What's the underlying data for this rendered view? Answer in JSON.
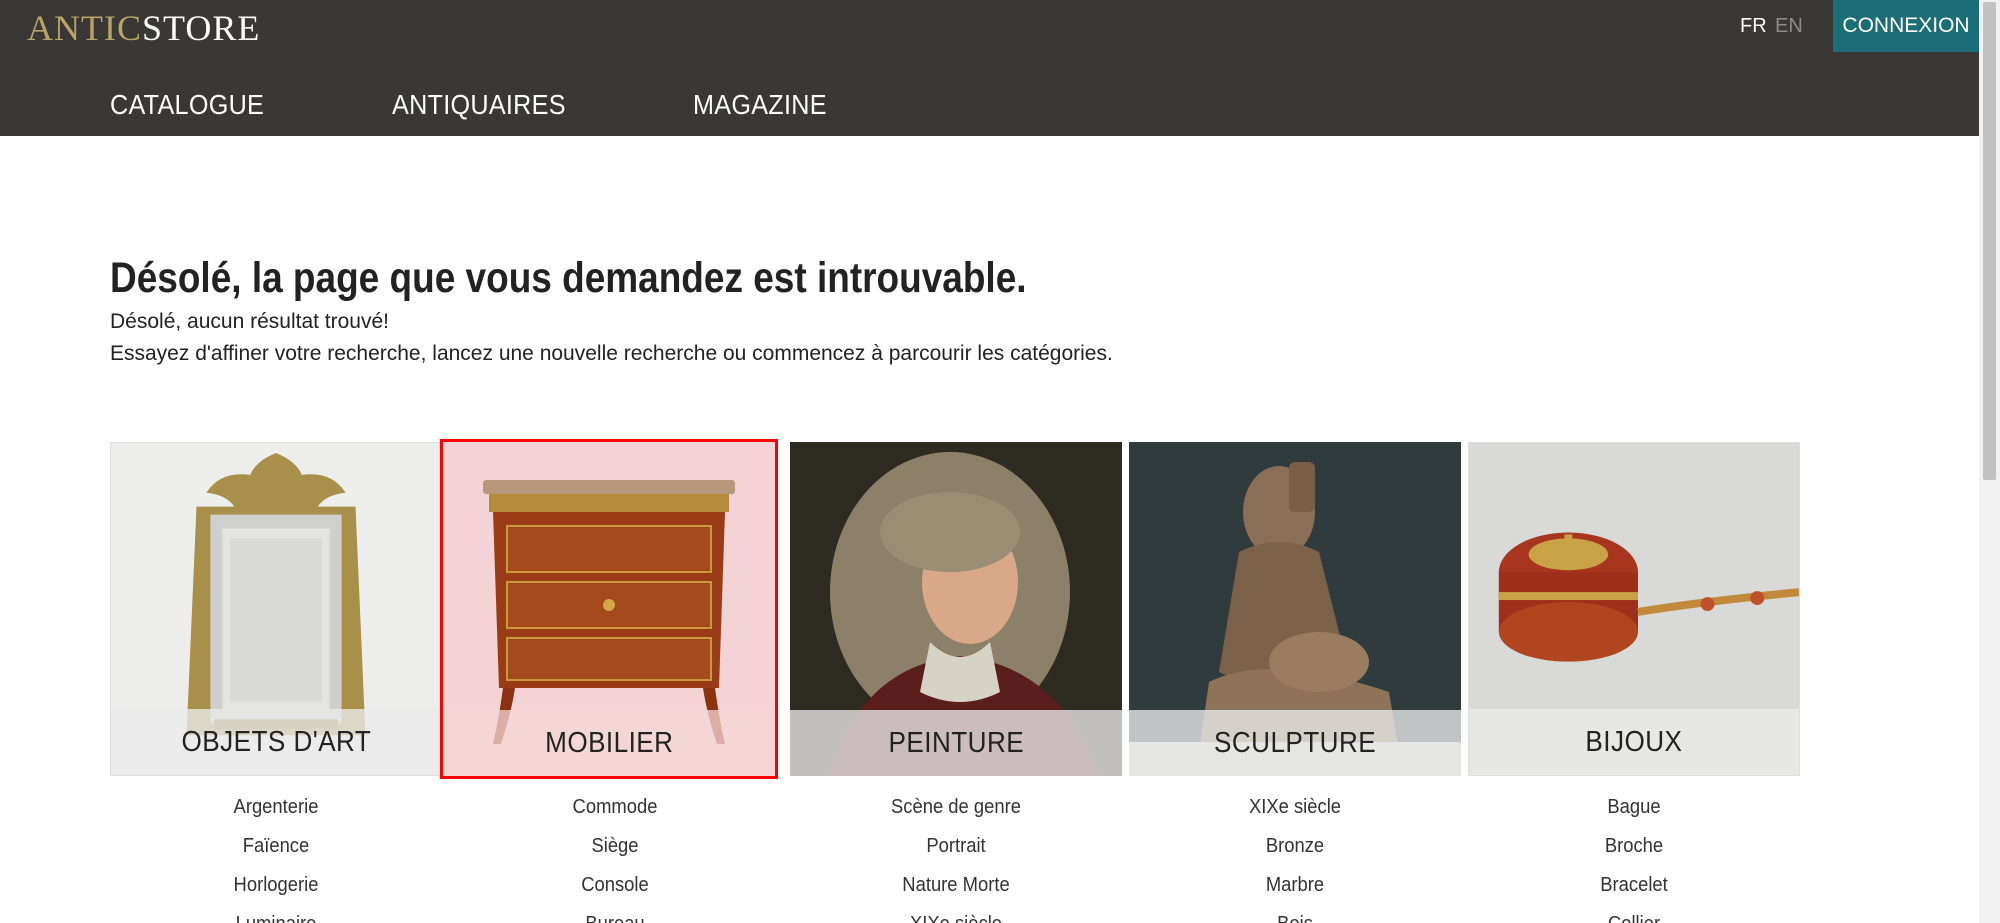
{
  "header": {
    "logo_part1": "ANTIC",
    "logo_part2": "STORE",
    "lang_fr": "FR",
    "lang_en": "EN",
    "login_label": "CONNEXION",
    "nav": [
      "CATALOGUE",
      "ANTIQUAIRES",
      "MAGAZINE"
    ]
  },
  "main": {
    "title": "Désolé, la page que vous demandez est introuvable.",
    "message1": "Désolé, aucun résultat trouvé!",
    "message2": "Essayez d'affiner votre recherche, lancez une nouvelle recherche ou commencez à parcourir les catégories."
  },
  "categories": [
    {
      "name": "OBJETS D'ART",
      "icon": "mirror-image",
      "subs": [
        "Argenterie",
        "Faïence",
        "Horlogerie",
        "Luminaire"
      ]
    },
    {
      "name": "MOBILIER",
      "icon": "commode-image",
      "selected": true,
      "subs": [
        "Commode",
        "Siège",
        "Console",
        "Bureau"
      ]
    },
    {
      "name": "PEINTURE",
      "icon": "portrait-image",
      "subs": [
        "Scène de genre",
        "Portrait",
        "Nature Morte",
        "XIXe siècle"
      ]
    },
    {
      "name": "SCULPTURE",
      "icon": "statue-image",
      "subs": [
        "XIXe siècle",
        "Bronze",
        "Marbre",
        "Bois"
      ]
    },
    {
      "name": "BIJOUX",
      "icon": "jewel-box-image",
      "subs": [
        "Bague",
        "Broche",
        "Bracelet",
        "Collier"
      ]
    }
  ],
  "colors": {
    "header_bg": "#393834",
    "logo_gold": "#b9a36a",
    "login_bg": "#1b6d78",
    "selected_outline": "#ff0000"
  }
}
